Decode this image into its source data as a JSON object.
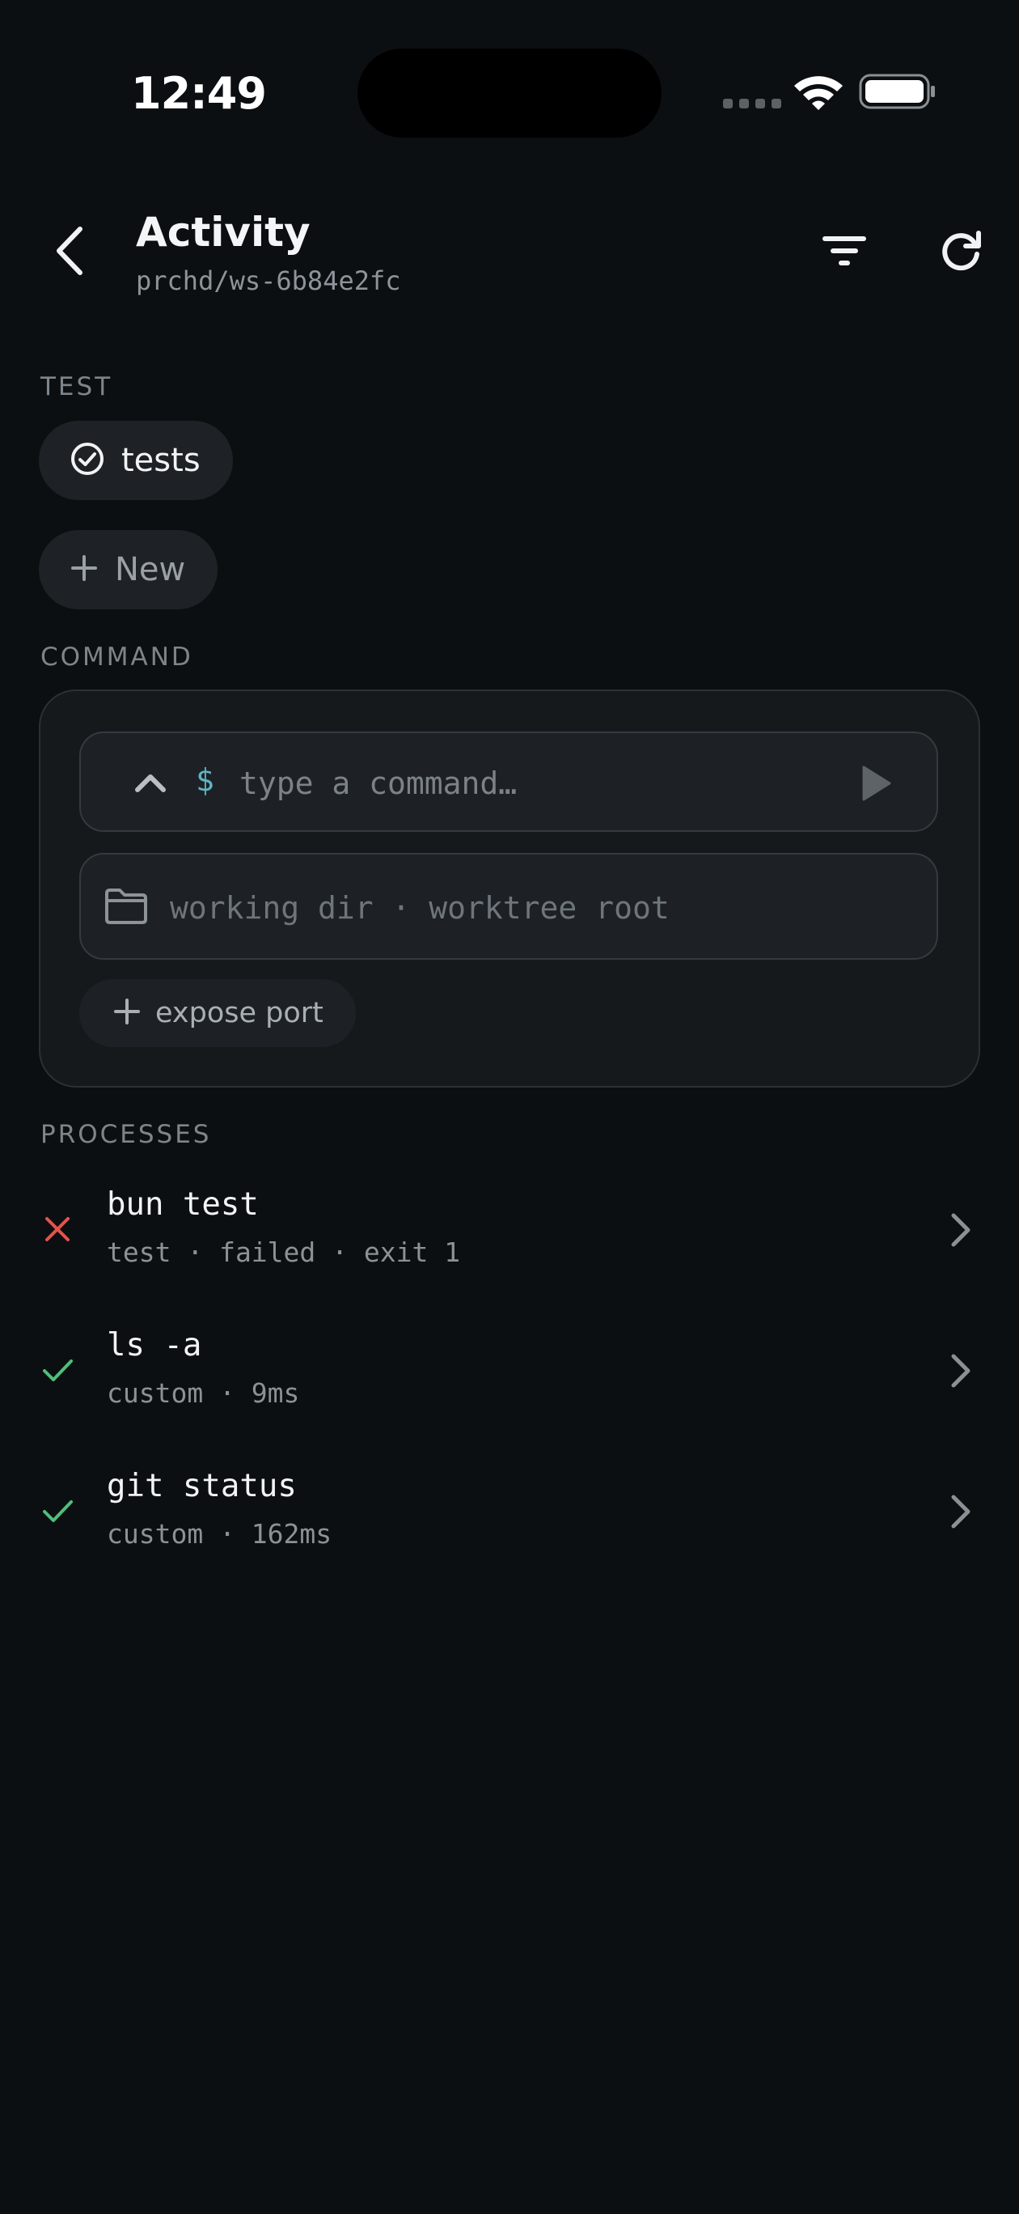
{
  "status_bar": {
    "time": "12:49"
  },
  "header": {
    "title": "Activity",
    "subtitle": "prchd/ws-6b84e2fc",
    "icons": {
      "back": "chevron-left-icon",
      "filter": "filter-icon",
      "refresh": "refresh-icon"
    }
  },
  "test_section": {
    "label": "TEST",
    "items": [
      {
        "label": "tests",
        "icon": "check-circle-icon"
      }
    ],
    "new_label": "New"
  },
  "command_section": {
    "label": "COMMAND",
    "prompt_symbol": "$",
    "command_value": "",
    "command_placeholder": "type a command…",
    "dir_value": "",
    "dir_placeholder": "working dir · worktree root",
    "expose_port_label": "expose port"
  },
  "processes_section": {
    "label": "PROCESSES",
    "items": [
      {
        "name": "bun test",
        "meta": "test · failed · exit 1",
        "status": "failed"
      },
      {
        "name": "ls -a",
        "meta": "custom · 9ms",
        "status": "success"
      },
      {
        "name": "git status",
        "meta": "custom · 162ms",
        "status": "success"
      }
    ]
  },
  "colors": {
    "background": "#0c0f11",
    "success": "#4fbf7a",
    "error": "#e5534b",
    "accent": "#5fb4c2"
  }
}
